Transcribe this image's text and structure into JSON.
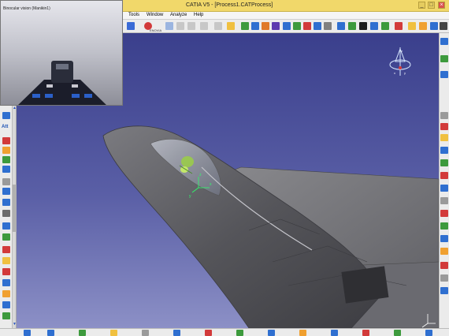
{
  "window": {
    "title": "CATIA V5 - [Process1.CATProcess]",
    "minimize": "_",
    "maximize": "□",
    "close": "×"
  },
  "menu": {
    "items": [
      "Tools",
      "Window",
      "Analyze",
      "Help"
    ]
  },
  "toolbar": {
    "enovia_label": "ENOVIA"
  },
  "binocular": {
    "title": "Binocular vision (Manikin1)"
  },
  "left_toolbar": {
    "label": "Att"
  },
  "scroll": {
    "down_arrow": "▼",
    "up_arrow": "▲"
  },
  "compass": {
    "axis_x": "x",
    "axis_y": "y",
    "axis_z": "z"
  },
  "manikin_axes": {
    "x": "x",
    "y": "y",
    "z": "z"
  }
}
